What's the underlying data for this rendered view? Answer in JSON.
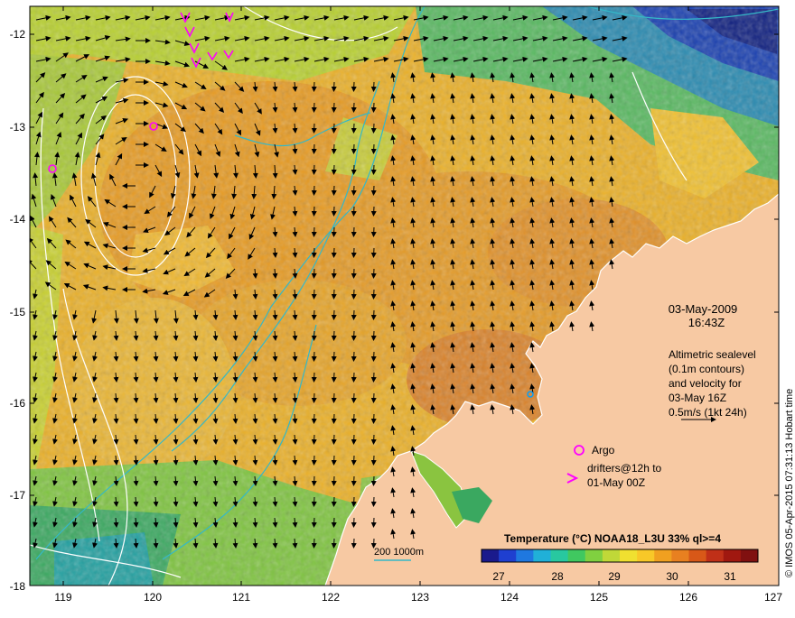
{
  "map": {
    "date": "03-May-2009",
    "time": "16:43Z",
    "altimetry_lines": [
      "Altimetric sealevel",
      "(0.1m contours)",
      "and velocity for",
      "03-May 16Z",
      "0.5m/s (1kt 24h)"
    ],
    "argo_label": "Argo",
    "drifters_lines": [
      "drifters@12h to",
      "01-May 00Z"
    ],
    "colorbar": {
      "title": "Temperature (°C) NOAA18_L3U 33% ql>=4",
      "ticks": [
        "27",
        "28",
        "29",
        "30",
        "31"
      ]
    },
    "bathymetry_label": "200  1000m",
    "credit": "© IMOS 05-Apr-2015 07:31:13 Hobart time",
    "axes": {
      "lat_ticks": [
        "-12",
        "-13",
        "-14",
        "-15",
        "-16",
        "-17",
        "-18"
      ],
      "lon_ticks": [
        "119",
        "120",
        "121",
        "122",
        "123",
        "124",
        "125",
        "126",
        "127"
      ]
    },
    "colors": {
      "land": "#f7c9a3",
      "sst_warm": "#e8a020",
      "sst_cool": "#2a50c8",
      "contour": "#ffffff",
      "bathymetry": "#34b8c8",
      "argo_marker": "#ff00ff",
      "drifter_marker": "#ff00ff"
    }
  }
}
